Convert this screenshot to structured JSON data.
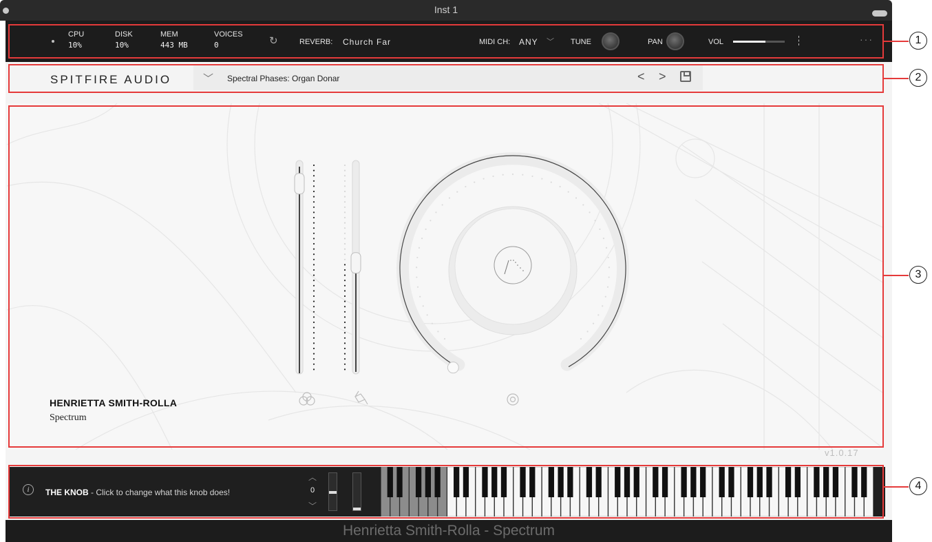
{
  "window": {
    "title": "Inst 1"
  },
  "status": {
    "cpu_label": "CPU",
    "cpu_value": "10%",
    "disk_label": "DISK",
    "disk_value": "10%",
    "mem_label": "MEM",
    "mem_value": "443 MB",
    "voices_label": "VOICES",
    "voices_value": "0",
    "reverb_label": "REVERB:",
    "reverb_value": "Church Far",
    "midi_label": "MIDI CH:",
    "midi_value": "ANY",
    "tune_label": "TUNE",
    "pan_label": "PAN",
    "vol_label": "VOL",
    "vol_level": 0.62,
    "more_label": "···"
  },
  "preset": {
    "brand": "SPITFIRE AUDIO",
    "name": "Spectral Phases: Organ Donar"
  },
  "main": {
    "artist_name": "HENRIETTA SMITH-ROLLA",
    "artist_sub": "Spectrum",
    "slider_1_level": 0.95,
    "slider_2_level": 0.53,
    "knob_level": 0.0,
    "icons": [
      "expression-icon",
      "dynamics-icon",
      "knob-target-icon"
    ],
    "version": "v1.0.17"
  },
  "keyboard": {
    "tip_title": "THE KNOB",
    "tip_text": " - Click to change what this knob does!",
    "octave_value": "0"
  },
  "footer": {
    "title": "Henrietta Smith-Rolla - Spectrum"
  },
  "callouts": [
    "1",
    "2",
    "3",
    "4"
  ],
  "colors": {
    "accent": "#e53a3a",
    "statusbar": "#1c1c1c",
    "panel": "#f7f7f7"
  }
}
